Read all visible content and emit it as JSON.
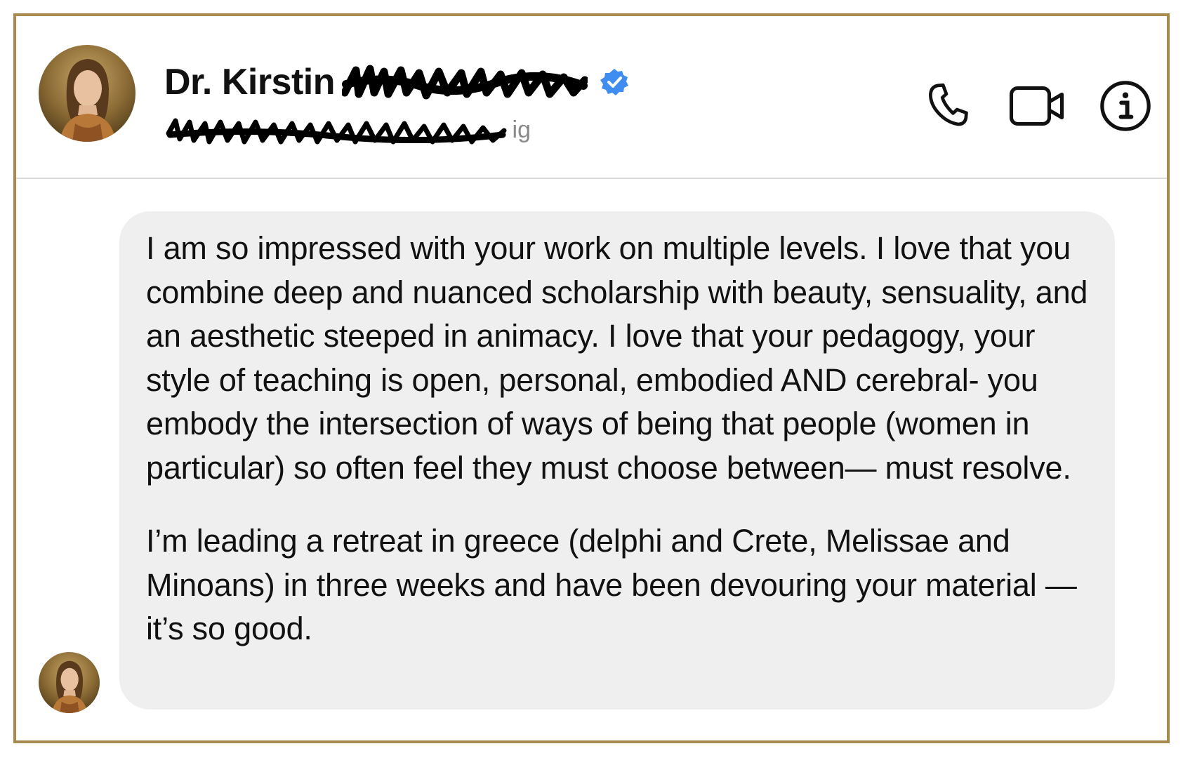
{
  "colors": {
    "frame_border": "#a88a4e",
    "verified_badge": "#3f8df0",
    "bubble_background": "#efefef",
    "subtitle_text": "#8a8a8a"
  },
  "header": {
    "contact_name": "Dr. Kirstin",
    "subtitle_visible_fragment": "ig",
    "icons": [
      "phone-icon",
      "video-call-icon",
      "info-icon",
      "verified-badge-icon"
    ]
  },
  "messages": [
    {
      "paragraphs": [
        "I am so impressed with your work on multiple levels. I love that you combine deep and nuanced scholarship with beauty, sensuality, and an aesthetic steeped in animacy. I love that your pedagogy, your style of teaching is open, personal, embodied AND cerebral- you embody the intersection of ways of being that people (women in particular) so often feel they must choose between— must resolve.",
        "I’m leading a retreat in greece (delphi and Crete, Melissae and Minoans) in three weeks and have been devouring your material — it’s so good."
      ]
    }
  ]
}
